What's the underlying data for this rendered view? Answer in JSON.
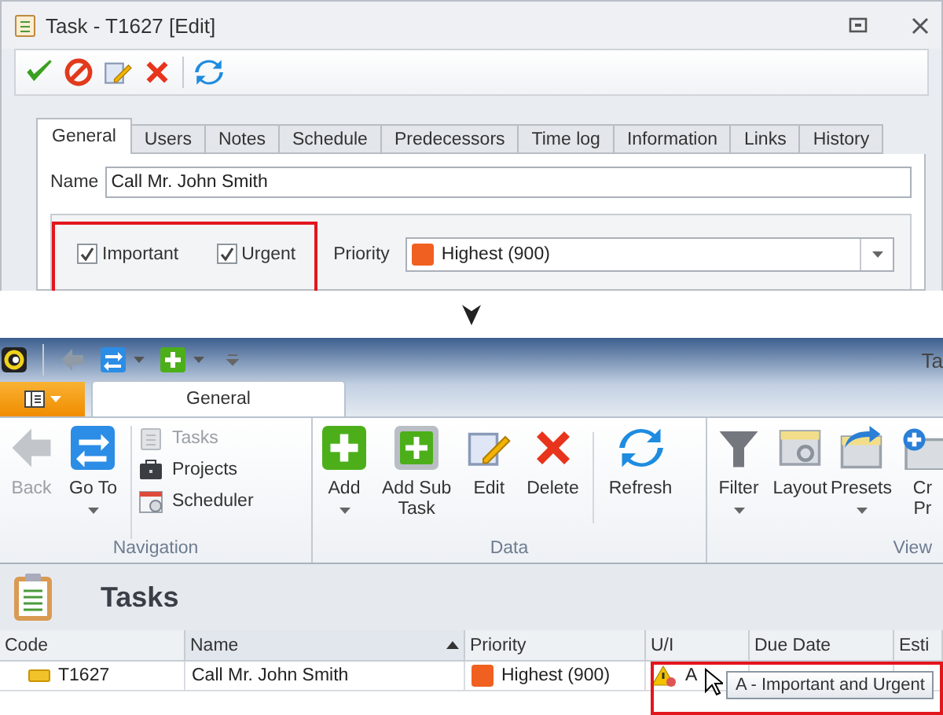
{
  "dialog": {
    "title": "Task - T1627 [Edit]",
    "toolbar": [
      {
        "kind": "save"
      },
      {
        "kind": "cancel"
      },
      {
        "kind": "edit"
      },
      {
        "kind": "delete"
      },
      {
        "kind": "separator"
      },
      {
        "kind": "refresh"
      }
    ],
    "tabs": [
      {
        "label": "General",
        "selected": true
      },
      {
        "label": "Users",
        "selected": false
      },
      {
        "label": "Notes",
        "selected": false
      },
      {
        "label": "Schedule",
        "selected": false
      },
      {
        "label": "Predecessors",
        "selected": false
      },
      {
        "label": "Time log",
        "selected": false
      },
      {
        "label": "Information",
        "selected": false
      },
      {
        "label": "Links",
        "selected": false
      },
      {
        "label": "History",
        "selected": false
      }
    ],
    "name": {
      "label": "Name",
      "value": "Call Mr. John Smith"
    },
    "flags": {
      "highlighted": true,
      "checkboxes": [
        {
          "label": "Important",
          "checked": true
        },
        {
          "label": "Urgent",
          "checked": true
        }
      ]
    },
    "priority": {
      "label": "Priority",
      "value": "Highest (900)",
      "color": "#f06020"
    }
  },
  "ribbon": {
    "title": "Ta",
    "quick_access": [
      {
        "kind": "back"
      },
      {
        "kind": "goto",
        "dropdown": true
      },
      {
        "kind": "add",
        "dropdown": true
      },
      {
        "kind": "customize"
      }
    ],
    "tabs": [
      {
        "label": "General",
        "selected": true
      }
    ],
    "groups": [
      {
        "label": "Navigation",
        "buttons": [
          {
            "kind": "back",
            "lines": [
              "Back"
            ],
            "disabled": true
          },
          {
            "kind": "goto",
            "lines": [
              "Go To"
            ],
            "disabled": false,
            "dropdown": true
          }
        ],
        "small_buttons": [
          {
            "kind": "tasks",
            "label": "Tasks",
            "disabled": true
          },
          {
            "kind": "projects",
            "label": "Projects",
            "disabled": false
          },
          {
            "kind": "scheduler",
            "label": "Scheduler",
            "disabled": false
          }
        ]
      },
      {
        "label": "Data",
        "buttons": [
          {
            "kind": "add",
            "lines": [
              "Add"
            ],
            "disabled": false,
            "dropdown": true
          },
          {
            "kind": "addsub",
            "lines": [
              "Add Sub",
              "Task"
            ],
            "disabled": false
          },
          {
            "kind": "edit",
            "lines": [
              "Edit"
            ],
            "disabled": false
          },
          {
            "kind": "delete",
            "lines": [
              "Delete"
            ],
            "disabled": false
          },
          {
            "kind": "refresh",
            "lines": [
              "Refresh"
            ],
            "disabled": false
          }
        ]
      },
      {
        "label": "View",
        "buttons": [
          {
            "kind": "filter",
            "lines": [
              "Filter"
            ],
            "disabled": false,
            "dropdown": true
          },
          {
            "kind": "layout",
            "lines": [
              "Layout"
            ],
            "disabled": false
          },
          {
            "kind": "presets",
            "lines": [
              "Presets"
            ],
            "disabled": false,
            "dropdown": true
          },
          {
            "kind": "create",
            "lines": [
              "Cr",
              "Pr"
            ],
            "disabled": false
          }
        ]
      }
    ]
  },
  "tasks": {
    "title": "Tasks",
    "columns": [
      {
        "label": "Code",
        "sorted": false
      },
      {
        "label": "Name",
        "sorted": true
      },
      {
        "label": "Priority",
        "sorted": false
      },
      {
        "label": "U/I",
        "sorted": false
      },
      {
        "label": "Due Date",
        "sorted": false
      },
      {
        "label": "Esti",
        "sorted": false
      }
    ],
    "rows": [
      {
        "code": "T1627",
        "name": "Call Mr. John Smith",
        "priority": "Highest (900)",
        "color": "#f06020",
        "ui": "A",
        "warning": true
      }
    ],
    "tooltip": {
      "text": "A - Important and Urgent",
      "highlighted": true
    }
  }
}
